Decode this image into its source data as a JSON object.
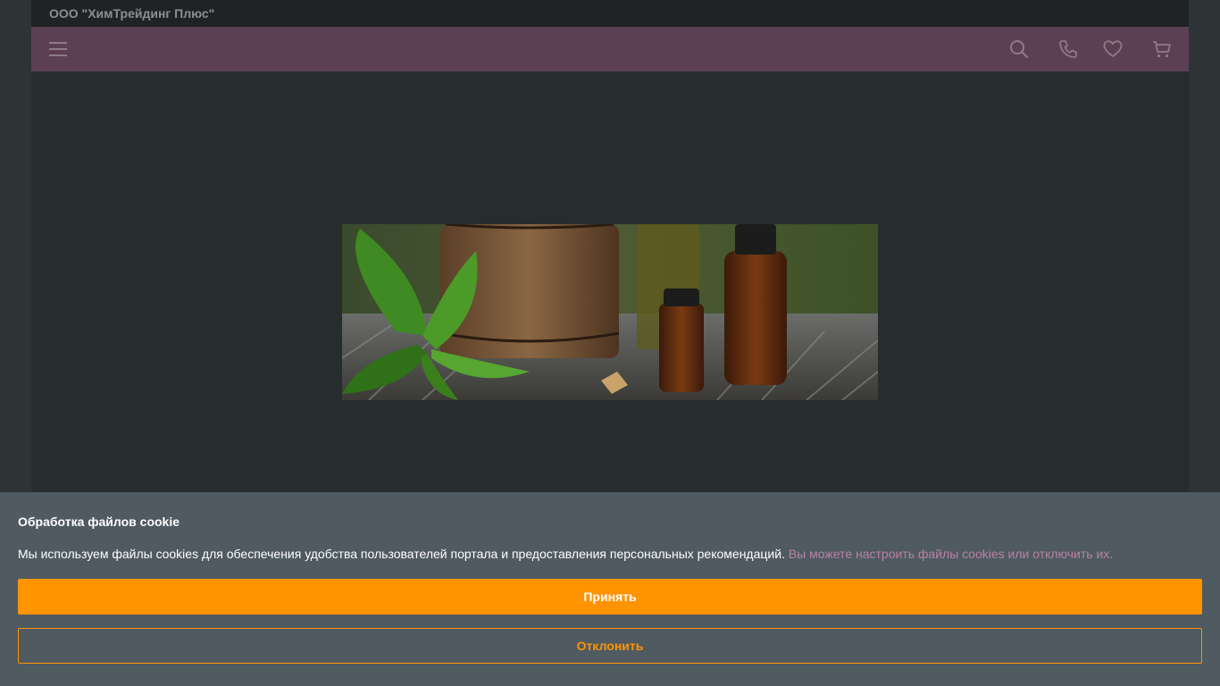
{
  "header": {
    "company_name": "ООО \"ХимТрейдинг Плюс\""
  },
  "navbar": {
    "icons": [
      "menu-icon",
      "search-icon",
      "phone-icon",
      "heart-icon",
      "cart-icon"
    ]
  },
  "cookie_banner": {
    "title": "Обработка файлов cookie",
    "text": "Мы используем файлы cookies для обеспечения удобства пользователей портала и предоставления персональных рекомендаций.",
    "link_text": "Вы можете настроить файлы cookies или отключить их.",
    "accept_label": "Принять",
    "decline_label": "Отклонить"
  },
  "colors": {
    "navbar": "#5c3f52",
    "accent": "#ff9400",
    "link": "#b883a5",
    "cookie_background": "#4f5a61"
  }
}
